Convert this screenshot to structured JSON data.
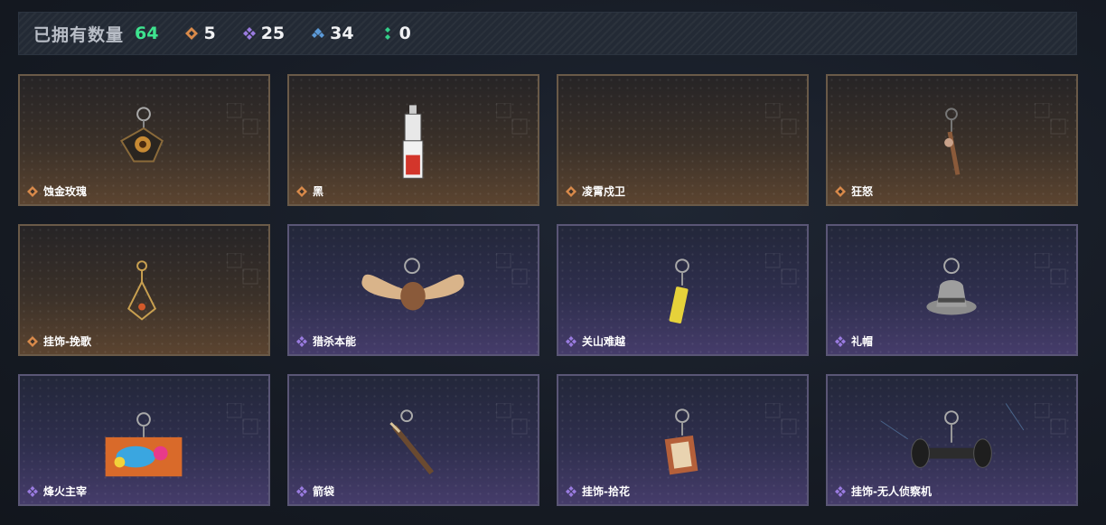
{
  "header": {
    "owned_label": "已拥有数量",
    "owned_count": "64",
    "stats": [
      {
        "icon": "orange-diamond-icon",
        "value": "5",
        "color": "#d98a4a"
      },
      {
        "icon": "purple-diamond-icon",
        "value": "25",
        "color": "#9a7be0"
      },
      {
        "icon": "blue-diamond-icon",
        "value": "34",
        "color": "#5c9ad8"
      },
      {
        "icon": "green-diamond-icon",
        "value": "0",
        "color": "#34d08a"
      }
    ]
  },
  "items": [
    {
      "name": "蚀金玫瑰",
      "rarity": "orange"
    },
    {
      "name": "黑",
      "rarity": "orange"
    },
    {
      "name": "凌霄戍卫",
      "rarity": "orange"
    },
    {
      "name": "狂怒",
      "rarity": "orange"
    },
    {
      "name": "挂饰-挽歌",
      "rarity": "orange"
    },
    {
      "name": "猎杀本能",
      "rarity": "purple"
    },
    {
      "name": "关山难越",
      "rarity": "purple"
    },
    {
      "name": "礼帽",
      "rarity": "purple"
    },
    {
      "name": "烽火主宰",
      "rarity": "purple"
    },
    {
      "name": "箭袋",
      "rarity": "purple"
    },
    {
      "name": "挂饰-拾花",
      "rarity": "purple"
    },
    {
      "name": "挂饰-无人侦察机",
      "rarity": "purple"
    }
  ],
  "colors": {
    "orange_rarity": "#d98a4a",
    "purple_rarity": "#9a7be0",
    "owned_count": "#3ee38f"
  }
}
